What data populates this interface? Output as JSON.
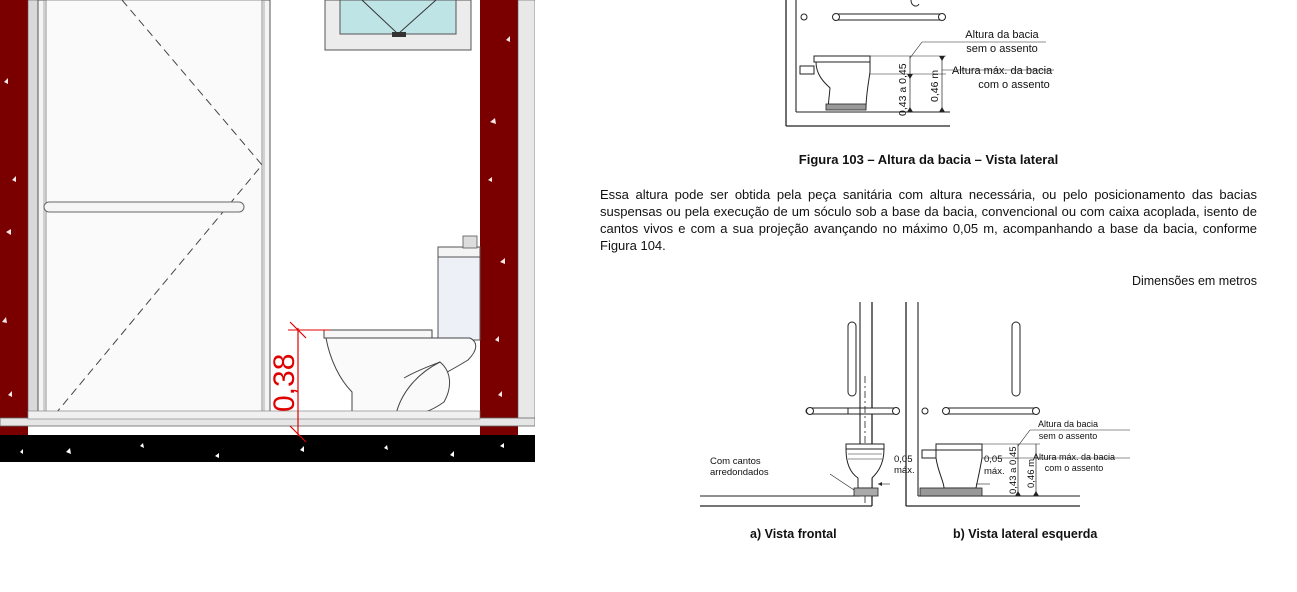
{
  "cad_view": {
    "dimension_label": "0,38",
    "colors": {
      "wall": "#7a0000",
      "dimension": "#e00000",
      "floor": "#000000",
      "tile": "#bfe4e6"
    }
  },
  "document": {
    "figure_103": {
      "label_height_no_seat_line1": "Altura da bacia",
      "label_height_no_seat_line2": "sem o assento",
      "label_max_height_line1": "Altura máx. da bacia",
      "label_max_height_line2": "com o assento",
      "dim_range": "0,43 a 0,45",
      "dim_max": "0,46 m",
      "caption": "Figura 103 – Altura da bacia – Vista lateral"
    },
    "paragraph": "Essa altura pode ser obtida pela peça sanitária com altura necessária, ou pelo posicionamento das bacias suspensas ou pela execução de um sóculo sob a base da bacia, convencional ou com caixa acoplada, isento de cantos vivos e com a sua projeção avançando no máximo 0,05 m, acompanhando a base da bacia, conforme Figura 104.",
    "dimensions_note": "Dimensões em metros",
    "figure_104": {
      "front_label_line1": "Com cantos",
      "front_label_line2": "arredondados",
      "front_offset_value": "0,05",
      "front_offset_unit": "máx.",
      "side_offset_value": "0,05",
      "side_offset_unit": "máx.",
      "side_label_height_line1": "Altura da bacia",
      "side_label_height_line2": "sem o assento",
      "side_label_max_line1": "Altura máx. da bacia",
      "side_label_max_line2": "com o assento",
      "side_dim_range": "0,43 a 0,45",
      "side_dim_max": "0,46 m",
      "caption_a": "a) Vista frontal",
      "caption_b": "b) Vista lateral esquerda"
    }
  }
}
